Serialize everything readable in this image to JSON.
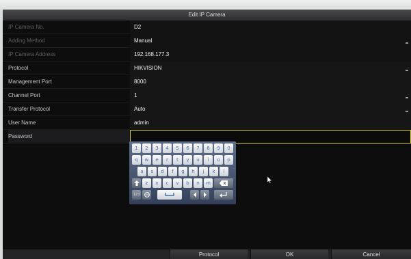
{
  "dialog": {
    "title": "Edit IP Camera"
  },
  "fields": [
    {
      "label": "IP Camera No.",
      "value": "D2"
    },
    {
      "label": "Adding Method",
      "value": "Manual"
    },
    {
      "label": "IP Camera Address",
      "value": "192.168.177.3"
    },
    {
      "label": "Protocol",
      "value": "HIKVISION"
    },
    {
      "label": "Management Port",
      "value": "8000"
    },
    {
      "label": "Channel Port",
      "value": "1"
    },
    {
      "label": "Transfer Protocol",
      "value": "Auto"
    },
    {
      "label": "User Name",
      "value": "admin"
    },
    {
      "label": "Password",
      "value": ""
    }
  ],
  "keyboard": {
    "row1": [
      "1",
      "2",
      "3",
      "4",
      "5",
      "6",
      "7",
      "8",
      "9",
      "0"
    ],
    "row2": [
      "q",
      "w",
      "e",
      "r",
      "t",
      "y",
      "u",
      "i",
      "o",
      "p"
    ],
    "row3": [
      "a",
      "s",
      "d",
      "f",
      "g",
      "h",
      "j",
      "k",
      "l"
    ],
    "row4": [
      "z",
      "x",
      "c",
      "v",
      "b",
      "n",
      "m"
    ],
    "shift_icon": "shift-arrow-icon",
    "backspace_icon": "backspace-icon",
    "mode_label": "123",
    "language_icon": "globe-icon",
    "space_icon": "space-bar-icon",
    "left_icon": "arrow-left-icon",
    "right_icon": "arrow-right-icon",
    "enter_icon": "enter-icon"
  },
  "buttons": {
    "protocol": "Protocol",
    "ok": "OK",
    "cancel": "Cancel"
  },
  "colors": {
    "focus_border": "#d5cf3c",
    "keyboard_bg": "#4a5a78",
    "key_text": "#3b6fb3"
  }
}
